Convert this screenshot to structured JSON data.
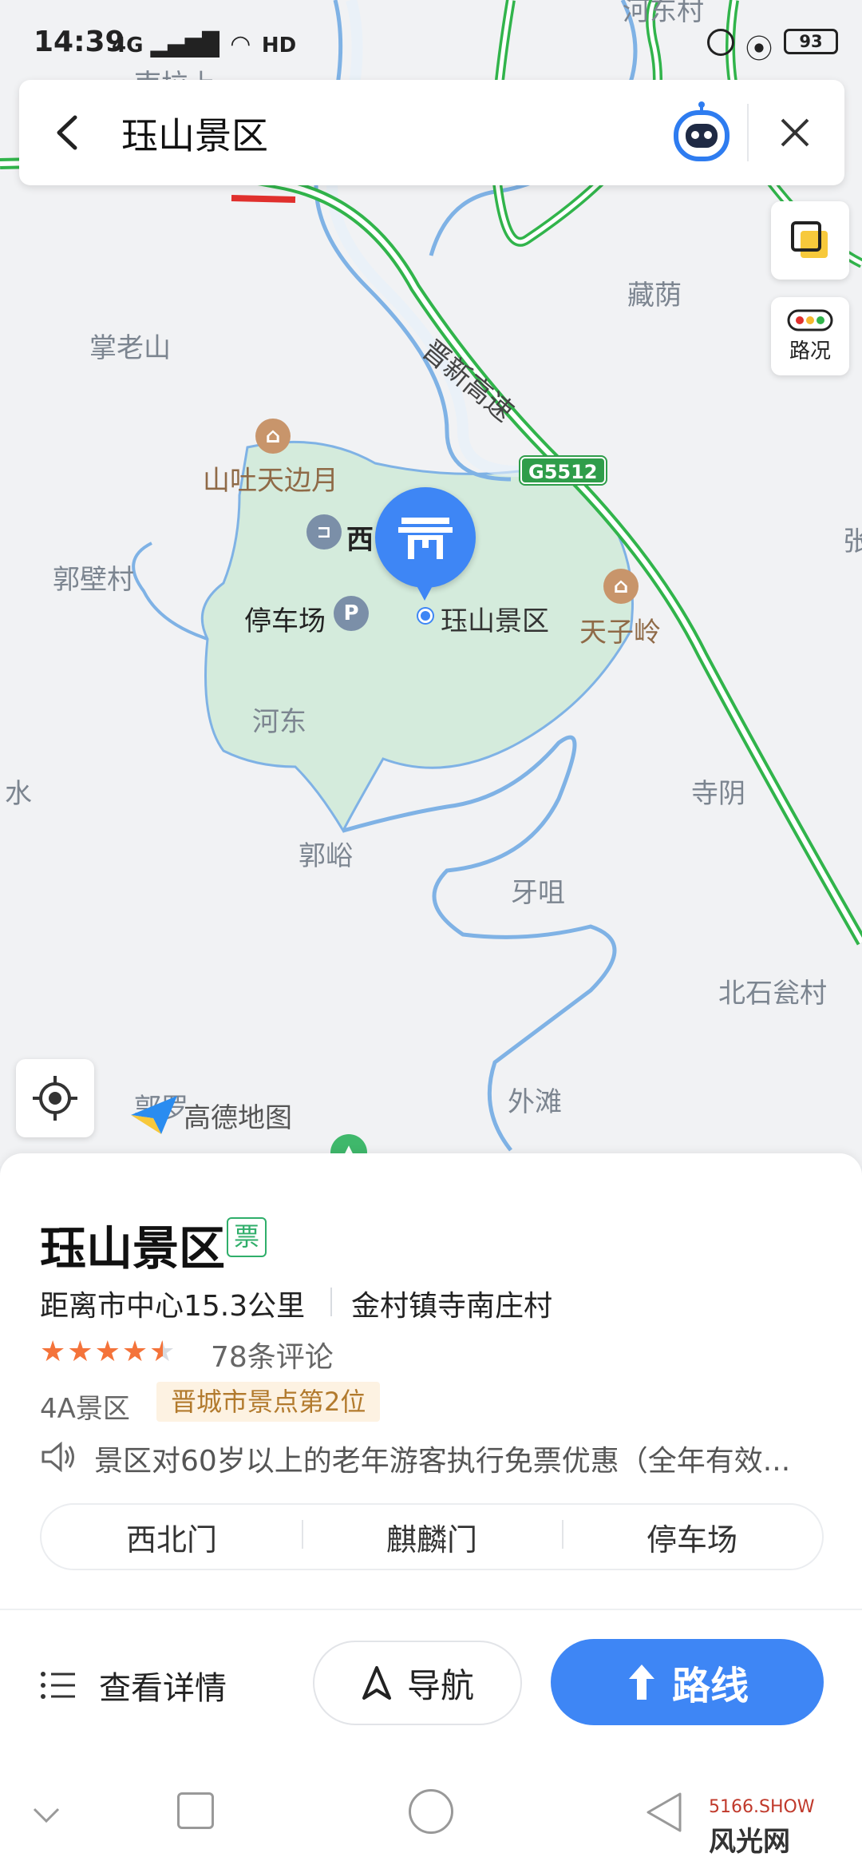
{
  "status_bar": {
    "time": "14:39",
    "signal": "4G",
    "battery": "93"
  },
  "search": {
    "query": "珏山景区"
  },
  "side_buttons": {
    "traffic_label": "路况"
  },
  "map": {
    "labels": [
      "河东村",
      "南垃上",
      "藏荫",
      "掌老山",
      "郭壁村",
      "河东",
      "寺阴",
      "郭峪",
      "牙咀",
      "北石瓮村",
      "外滩",
      "水",
      "张",
      "郭罗"
    ],
    "road_name": "晋新高速",
    "road_shield": "G5512",
    "pois": {
      "shantu": "山吐天边月",
      "west": "西",
      "parking": "停车场",
      "scenic": "珏山景区",
      "tianziling": "天子岭"
    },
    "brand": "高德地图"
  },
  "place": {
    "name": "珏山景区",
    "ticket_badge": "票",
    "distance": "距离市中心15.3公里",
    "address": "金村镇寺南庄村",
    "rating": 4.5,
    "reviews": "78条评论",
    "level": "4A景区",
    "rank": "晋城市景点第2位",
    "notice": "景区对60岁以上的老年游客执行免票优惠（全年有效..."
  },
  "entrances": [
    "西北门",
    "麒麟门",
    "停车场"
  ],
  "actions": {
    "details": "查看详情",
    "navigate": "导航",
    "route": "路线"
  },
  "watermark": {
    "site": "5166.SHOW",
    "name": "风光网"
  },
  "colors": {
    "accent": "#3e86f5",
    "highway": "#31b44b",
    "park": "#cfe8d6",
    "river": "#7fb2e5",
    "star": "#f4733a"
  }
}
